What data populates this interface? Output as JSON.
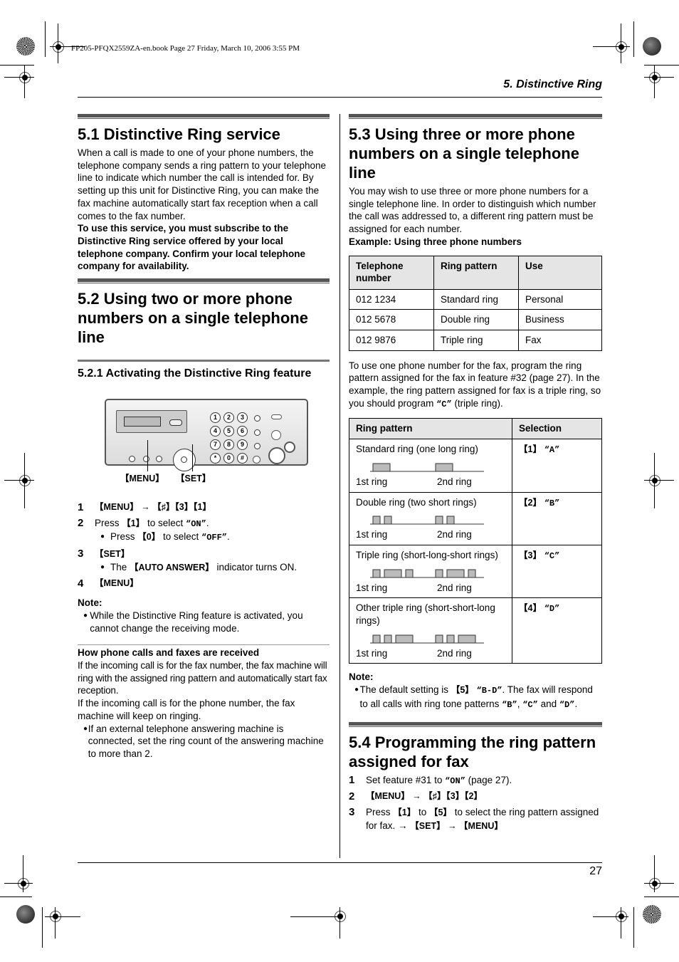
{
  "print_info": "FP205-PFQX2559ZA-en.book  Page 27  Friday, March 10, 2006  3:55 PM",
  "running_head": "5. Distinctive Ring",
  "page_number": "27",
  "s51": {
    "title": "5.1 Distinctive Ring service",
    "body": "When a call is made to one of your phone numbers, the telephone company sends a ring pattern to your telephone line to indicate which number the call is intended for. By setting up this unit for Distinctive Ring, you can make the fax machine automatically start fax reception when a call comes to the fax number.",
    "bold_body": "To use this service, you must subscribe to the Distinctive Ring service offered by your local telephone company. Confirm your local telephone company for availability."
  },
  "s52": {
    "title": "5.2 Using two or more phone numbers on a single telephone line",
    "sub_title": "5.2.1 Activating the Distinctive Ring feature",
    "device": {
      "keys": [
        "1",
        "2",
        "3",
        "4",
        "5",
        "6",
        "7",
        "8",
        "9",
        "*",
        "0",
        "#"
      ],
      "callout_menu": "【MENU】",
      "callout_set": "【SET】"
    },
    "steps": [
      {
        "num": "1",
        "text": "【MENU】 → 【♯】【3】【1】"
      },
      {
        "num": "2",
        "pre": "Press ",
        "key": "【1】",
        "mid": " to select ",
        "val": "“ON”",
        "post": ".",
        "bullet": {
          "pre": "Press ",
          "key": "【0】",
          "mid": " to select ",
          "val": "“OFF”",
          "post": "."
        }
      },
      {
        "num": "3",
        "text": "【SET】",
        "bullet": {
          "pre": "The ",
          "key": "【AUTO ANSWER】",
          "post": " indicator turns ON."
        }
      },
      {
        "num": "4",
        "text": "【MENU】"
      }
    ],
    "note_title": "Note:",
    "note": "While the Distinctive Ring feature is activated, you cannot change the receiving mode.",
    "how_title": "How phone calls and faxes are received",
    "how_p1": "If the incoming call is for the fax number, the fax machine will ring with the assigned ring pattern and automatically start fax reception.",
    "how_p2": "If the incoming call is for the phone number, the fax machine will keep on ringing.",
    "how_bullet": "If an external telephone answering machine is connected, set the ring count of the answering machine to more than 2."
  },
  "s53": {
    "title": "5.3 Using three or more phone numbers on a single telephone line",
    "body": "You may wish to use three or more phone numbers for a single telephone line. In order to distinguish which number the call was addressed to, a different ring pattern must be assigned for each number.",
    "example": "Example: Using three phone numbers",
    "table1": {
      "headers": [
        "Telephone number",
        "Ring pattern",
        "Use"
      ],
      "rows": [
        [
          "012 1234",
          "Standard ring",
          "Personal"
        ],
        [
          "012 5678",
          "Double ring",
          "Business"
        ],
        [
          "012 9876",
          "Triple ring",
          "Fax"
        ]
      ]
    },
    "after_table": "To use one phone number for the fax, program the ring pattern assigned for the fax in feature #32 (page 27). In the example, the ring pattern assigned for fax is a triple ring, so you should program ",
    "after_table_val": "“C”",
    "after_table_post": " (triple ring).",
    "table2": {
      "headers": [
        "Ring pattern",
        "Selection"
      ],
      "rows": [
        {
          "desc": "Standard ring (one long ring)",
          "pattern": [
            "L"
          ],
          "key": "【1】",
          "val": "“A”"
        },
        {
          "desc": "Double ring (two short rings)",
          "pattern": [
            "S",
            "S"
          ],
          "key": "【2】",
          "val": "“B”"
        },
        {
          "desc": "Triple ring (short-long-short rings)",
          "pattern": [
            "S",
            "L",
            "S"
          ],
          "key": "【3】",
          "val": "“C”"
        },
        {
          "desc": "Other triple ring (short-short-long rings)",
          "pattern": [
            "S",
            "S",
            "L"
          ],
          "key": "【4】",
          "val": "“D”"
        }
      ],
      "label_first": "1st ring",
      "label_second": "2nd ring"
    },
    "note_title": "Note:",
    "note_pre": "The default setting is ",
    "note_key": "【5】",
    "note_val": "“B-D”",
    "note_post": ". The fax will respond to all calls with ring tone patterns ",
    "note_b": "“B”",
    "note_c": "“C”",
    "note_d": "“D”"
  },
  "s54": {
    "title": "5.4 Programming the ring pattern assigned for fax",
    "steps": [
      {
        "num": "1",
        "pre": "Set feature #31 to ",
        "val": "“ON”",
        "post": " (page 27)."
      },
      {
        "num": "2",
        "text": "【MENU】 → 【♯】【3】【2】"
      },
      {
        "num": "3",
        "pre": "Press ",
        "k1": "【1】",
        "mid": " to ",
        "k2": "【5】",
        "post": " to select the ring pattern assigned for fax. → ",
        "k3": "【SET】 → 【MENU】"
      }
    ]
  }
}
